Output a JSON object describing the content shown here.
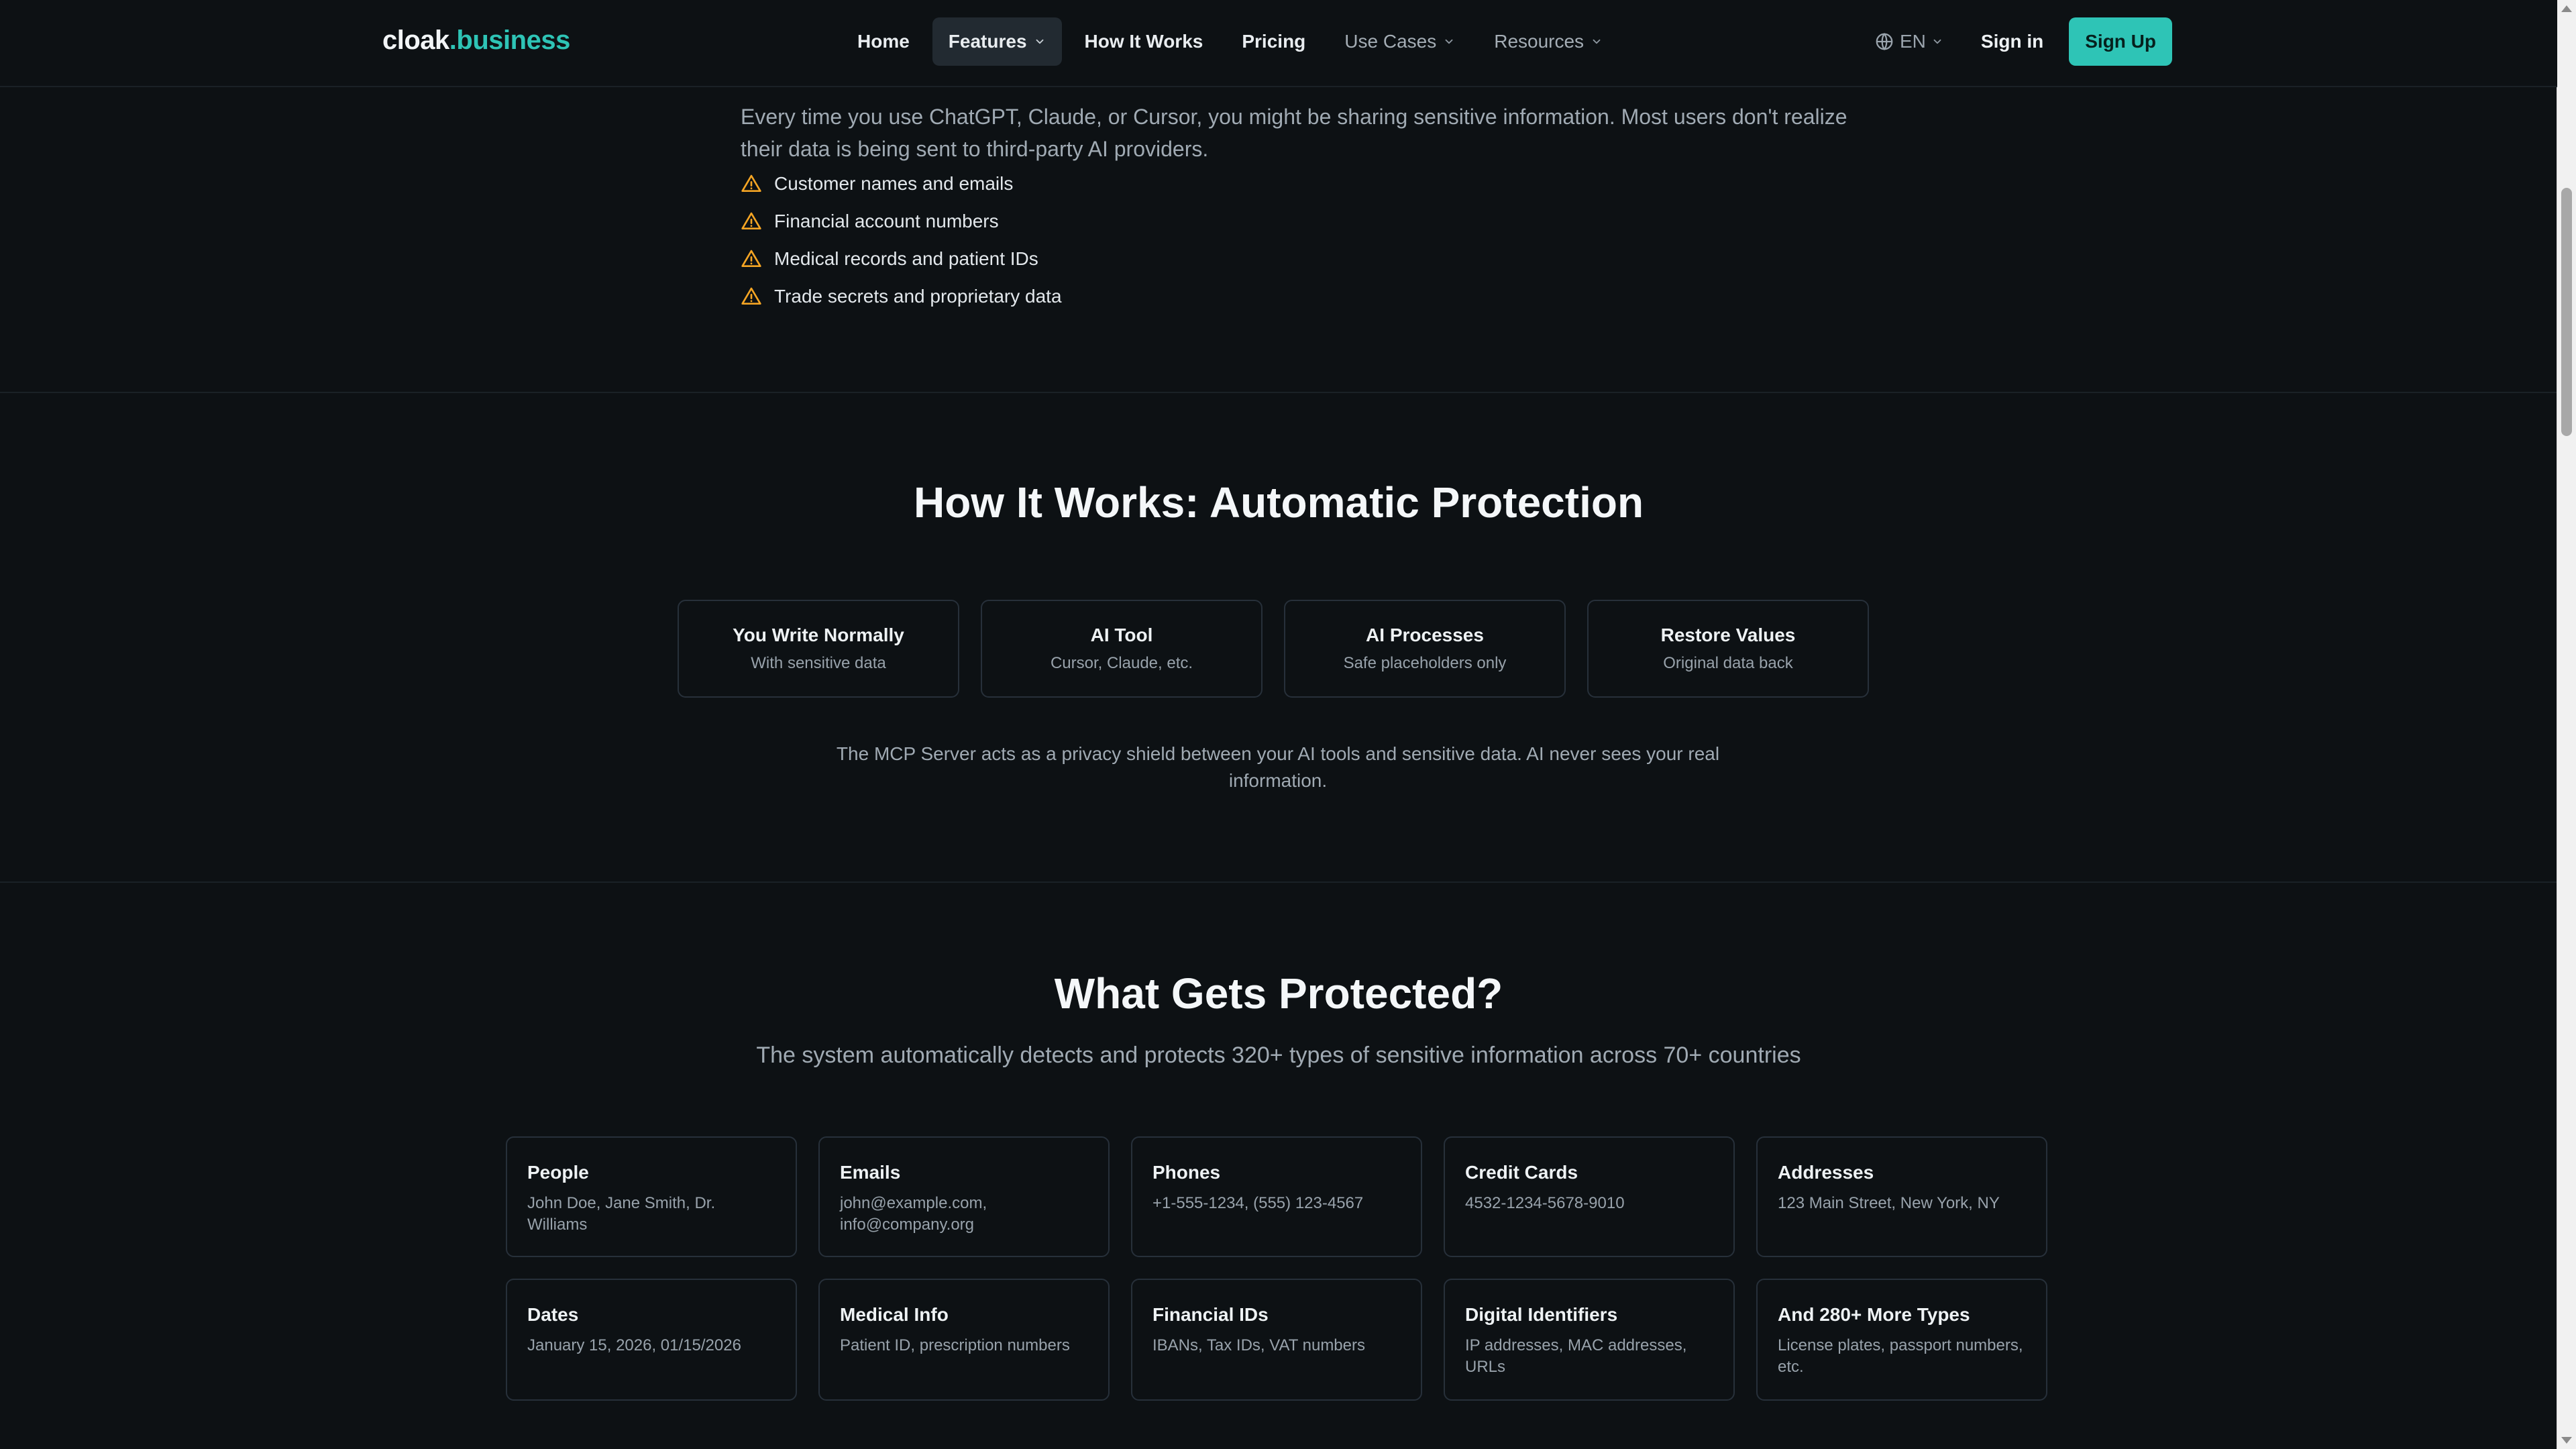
{
  "brand": {
    "part1": "cloak",
    "part2": ".business"
  },
  "nav": {
    "home": "Home",
    "features": "Features",
    "how_it_works": "How It Works",
    "pricing": "Pricing",
    "use_cases": "Use Cases",
    "resources": "Resources",
    "language": "EN",
    "sign_in": "Sign in",
    "sign_up": "Sign Up"
  },
  "problem": {
    "text": "Every time you use ChatGPT, Claude, or Cursor, you might be sharing sensitive information. Most users don't realize their data is being sent to third-party AI providers.",
    "risks": [
      "Customer names and emails",
      "Financial account numbers",
      "Medical records and patient IDs",
      "Trade secrets and proprietary data"
    ]
  },
  "how_it_works": {
    "title": "How It Works: Automatic Protection",
    "steps": [
      {
        "title": "You Write Normally",
        "desc": "With sensitive data"
      },
      {
        "title": "AI Tool",
        "desc": "Cursor, Claude, etc."
      },
      {
        "title": "AI Processes",
        "desc": "Safe placeholders only"
      },
      {
        "title": "Restore Values",
        "desc": "Original data back"
      }
    ],
    "note": "The MCP Server acts as a privacy shield between your AI tools and sensitive data. AI never sees your real information."
  },
  "protected": {
    "title": "What Gets Protected?",
    "subtitle": "The system automatically detects and protects 320+ types of sensitive information across 70+ countries",
    "types": [
      {
        "title": "People",
        "desc": "John Doe, Jane Smith, Dr. Williams"
      },
      {
        "title": "Emails",
        "desc": "john@example.com, info@company.org"
      },
      {
        "title": "Phones",
        "desc": "+1-555-1234, (555) 123-4567"
      },
      {
        "title": "Credit Cards",
        "desc": "4532-1234-5678-9010"
      },
      {
        "title": "Addresses",
        "desc": "123 Main Street, New York, NY"
      },
      {
        "title": "Dates",
        "desc": "January 15, 2026, 01/15/2026"
      },
      {
        "title": "Medical Info",
        "desc": "Patient ID, prescription numbers"
      },
      {
        "title": "Financial IDs",
        "desc": "IBANs, Tax IDs, VAT numbers"
      },
      {
        "title": "Digital Identifiers",
        "desc": "IP addresses, MAC addresses, URLs"
      },
      {
        "title": "And 280+ More Types",
        "desc": "License plates, passport numbers, etc."
      }
    ]
  },
  "colors": {
    "accent": "#2ec4b6",
    "warning": "#f5a524",
    "background": "#0d1114"
  }
}
